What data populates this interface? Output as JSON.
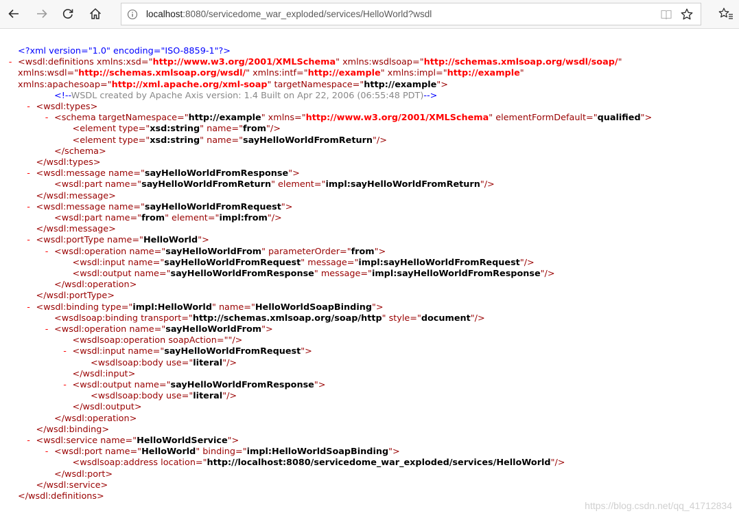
{
  "browser": {
    "url_host": "localhost",
    "url_path": ":8080/servicedome_war_exploded/services/HelloWorld?wsdl",
    "icons": [
      "back-arrow-icon",
      "forward-arrow-icon",
      "refresh-icon",
      "home-icon",
      "info-icon",
      "reading-view-icon",
      "favorite-star-icon",
      "favorites-hub-icon"
    ]
  },
  "colors": {
    "tag": "#990000",
    "toggle": "#ff0000",
    "namespace_value": "#ff0000",
    "processing_instruction": "#0000ff",
    "comment_text": "#888888",
    "value": "#000000"
  },
  "xml": {
    "lines": [
      {
        "toggle": "",
        "indent": 0,
        "parts": [
          [
            "p",
            "<?xml version=\"1.0\" encoding=\"ISO-8859-1\"?>"
          ]
        ]
      },
      {
        "toggle": "-",
        "indent": 0,
        "parts": [
          [
            "t",
            "<wsdl:definitions "
          ],
          [
            "a",
            "xmlns:xsd=\""
          ],
          [
            "ns",
            "http://www.w3.org/2001/XMLSchema"
          ],
          [
            "a",
            "\" xmlns:wsdlsoap=\""
          ],
          [
            "ns",
            "http://schemas.xmlsoap.org/wsdl/soap/"
          ],
          [
            "a",
            "\""
          ]
        ]
      },
      {
        "toggle": "",
        "indent": 0,
        "parts": [
          [
            "a",
            "xmlns:wsdl=\""
          ],
          [
            "ns",
            "http://schemas.xmlsoap.org/wsdl/"
          ],
          [
            "a",
            "\" xmlns:intf=\""
          ],
          [
            "ns",
            "http://example"
          ],
          [
            "a",
            "\" xmlns:impl=\""
          ],
          [
            "ns",
            "http://example"
          ],
          [
            "a",
            "\""
          ]
        ]
      },
      {
        "toggle": "",
        "indent": 0,
        "parts": [
          [
            "a",
            "xmlns:apachesoap=\""
          ],
          [
            "ns",
            "http://xml.apache.org/xml-soap"
          ],
          [
            "a",
            "\" targetNamespace=\""
          ],
          [
            "v",
            "http://example"
          ],
          [
            "t",
            "\">"
          ]
        ]
      },
      {
        "toggle": "",
        "indent": 2,
        "parts": [
          [
            "cmd",
            "<!--"
          ],
          [
            "cm",
            "WSDL created by Apache Axis version: 1.4 Built on Apr 22, 2006 (06:55:48 PDT)"
          ],
          [
            "cmd",
            "-->"
          ]
        ]
      },
      {
        "toggle": "-",
        "indent": 1,
        "parts": [
          [
            "t",
            "<wsdl:types>"
          ]
        ]
      },
      {
        "toggle": "-",
        "indent": 2,
        "parts": [
          [
            "t",
            "<schema "
          ],
          [
            "a",
            "targetNamespace=\""
          ],
          [
            "v",
            "http://example"
          ],
          [
            "a",
            "\" xmlns=\""
          ],
          [
            "ns",
            "http://www.w3.org/2001/XMLSchema"
          ],
          [
            "a",
            "\" elementFormDefault=\""
          ],
          [
            "v",
            "qualified"
          ],
          [
            "t",
            "\">"
          ]
        ]
      },
      {
        "toggle": "",
        "indent": 3,
        "parts": [
          [
            "t",
            "<element "
          ],
          [
            "a",
            "type=\""
          ],
          [
            "v",
            "xsd:string"
          ],
          [
            "a",
            "\" name=\""
          ],
          [
            "v",
            "from"
          ],
          [
            "t",
            "\"/>"
          ]
        ]
      },
      {
        "toggle": "",
        "indent": 3,
        "parts": [
          [
            "t",
            "<element "
          ],
          [
            "a",
            "type=\""
          ],
          [
            "v",
            "xsd:string"
          ],
          [
            "a",
            "\" name=\""
          ],
          [
            "v",
            "sayHelloWorldFromReturn"
          ],
          [
            "t",
            "\"/>"
          ]
        ]
      },
      {
        "toggle": "",
        "indent": 2,
        "parts": [
          [
            "t",
            "</schema>"
          ]
        ]
      },
      {
        "toggle": "",
        "indent": 1,
        "parts": [
          [
            "t",
            "</wsdl:types>"
          ]
        ]
      },
      {
        "toggle": "-",
        "indent": 1,
        "parts": [
          [
            "t",
            "<wsdl:message "
          ],
          [
            "a",
            "name=\""
          ],
          [
            "v",
            "sayHelloWorldFromResponse"
          ],
          [
            "t",
            "\">"
          ]
        ]
      },
      {
        "toggle": "",
        "indent": 2,
        "parts": [
          [
            "t",
            "<wsdl:part "
          ],
          [
            "a",
            "name=\""
          ],
          [
            "v",
            "sayHelloWorldFromReturn"
          ],
          [
            "a",
            "\" element=\""
          ],
          [
            "v",
            "impl:sayHelloWorldFromReturn"
          ],
          [
            "t",
            "\"/>"
          ]
        ]
      },
      {
        "toggle": "",
        "indent": 1,
        "parts": [
          [
            "t",
            "</wsdl:message>"
          ]
        ]
      },
      {
        "toggle": "-",
        "indent": 1,
        "parts": [
          [
            "t",
            "<wsdl:message "
          ],
          [
            "a",
            "name=\""
          ],
          [
            "v",
            "sayHelloWorldFromRequest"
          ],
          [
            "t",
            "\">"
          ]
        ]
      },
      {
        "toggle": "",
        "indent": 2,
        "parts": [
          [
            "t",
            "<wsdl:part "
          ],
          [
            "a",
            "name=\""
          ],
          [
            "v",
            "from"
          ],
          [
            "a",
            "\" element=\""
          ],
          [
            "v",
            "impl:from"
          ],
          [
            "t",
            "\"/>"
          ]
        ]
      },
      {
        "toggle": "",
        "indent": 1,
        "parts": [
          [
            "t",
            "</wsdl:message>"
          ]
        ]
      },
      {
        "toggle": "-",
        "indent": 1,
        "parts": [
          [
            "t",
            "<wsdl:portType "
          ],
          [
            "a",
            "name=\""
          ],
          [
            "v",
            "HelloWorld"
          ],
          [
            "t",
            "\">"
          ]
        ]
      },
      {
        "toggle": "-",
        "indent": 2,
        "parts": [
          [
            "t",
            "<wsdl:operation "
          ],
          [
            "a",
            "name=\""
          ],
          [
            "v",
            "sayHelloWorldFrom"
          ],
          [
            "a",
            "\" parameterOrder=\""
          ],
          [
            "v",
            "from"
          ],
          [
            "t",
            "\">"
          ]
        ]
      },
      {
        "toggle": "",
        "indent": 3,
        "parts": [
          [
            "t",
            "<wsdl:input "
          ],
          [
            "a",
            "name=\""
          ],
          [
            "v",
            "sayHelloWorldFromRequest"
          ],
          [
            "a",
            "\" message=\""
          ],
          [
            "v",
            "impl:sayHelloWorldFromRequest"
          ],
          [
            "t",
            "\"/>"
          ]
        ]
      },
      {
        "toggle": "",
        "indent": 3,
        "parts": [
          [
            "t",
            "<wsdl:output "
          ],
          [
            "a",
            "name=\""
          ],
          [
            "v",
            "sayHelloWorldFromResponse"
          ],
          [
            "a",
            "\" message=\""
          ],
          [
            "v",
            "impl:sayHelloWorldFromResponse"
          ],
          [
            "t",
            "\"/>"
          ]
        ]
      },
      {
        "toggle": "",
        "indent": 2,
        "parts": [
          [
            "t",
            "</wsdl:operation>"
          ]
        ]
      },
      {
        "toggle": "",
        "indent": 1,
        "parts": [
          [
            "t",
            "</wsdl:portType>"
          ]
        ]
      },
      {
        "toggle": "-",
        "indent": 1,
        "parts": [
          [
            "t",
            "<wsdl:binding "
          ],
          [
            "a",
            "type=\""
          ],
          [
            "v",
            "impl:HelloWorld"
          ],
          [
            "a",
            "\" name=\""
          ],
          [
            "v",
            "HelloWorldSoapBinding"
          ],
          [
            "t",
            "\">"
          ]
        ]
      },
      {
        "toggle": "",
        "indent": 2,
        "parts": [
          [
            "t",
            "<wsdlsoap:binding "
          ],
          [
            "a",
            "transport=\""
          ],
          [
            "v",
            "http://schemas.xmlsoap.org/soap/http"
          ],
          [
            "a",
            "\" style=\""
          ],
          [
            "v",
            "document"
          ],
          [
            "t",
            "\"/>"
          ]
        ]
      },
      {
        "toggle": "-",
        "indent": 2,
        "parts": [
          [
            "t",
            "<wsdl:operation "
          ],
          [
            "a",
            "name=\""
          ],
          [
            "v",
            "sayHelloWorldFrom"
          ],
          [
            "t",
            "\">"
          ]
        ]
      },
      {
        "toggle": "",
        "indent": 3,
        "parts": [
          [
            "t",
            "<wsdlsoap:operation "
          ],
          [
            "a",
            "soapAction=\""
          ],
          [
            "v",
            ""
          ],
          [
            "t",
            "\"/>"
          ]
        ]
      },
      {
        "toggle": "-",
        "indent": 3,
        "parts": [
          [
            "t",
            "<wsdl:input "
          ],
          [
            "a",
            "name=\""
          ],
          [
            "v",
            "sayHelloWorldFromRequest"
          ],
          [
            "t",
            "\">"
          ]
        ]
      },
      {
        "toggle": "",
        "indent": 4,
        "parts": [
          [
            "t",
            "<wsdlsoap:body "
          ],
          [
            "a",
            "use=\""
          ],
          [
            "v",
            "literal"
          ],
          [
            "t",
            "\"/>"
          ]
        ]
      },
      {
        "toggle": "",
        "indent": 3,
        "parts": [
          [
            "t",
            "</wsdl:input>"
          ]
        ]
      },
      {
        "toggle": "-",
        "indent": 3,
        "parts": [
          [
            "t",
            "<wsdl:output "
          ],
          [
            "a",
            "name=\""
          ],
          [
            "v",
            "sayHelloWorldFromResponse"
          ],
          [
            "t",
            "\">"
          ]
        ]
      },
      {
        "toggle": "",
        "indent": 4,
        "parts": [
          [
            "t",
            "<wsdlsoap:body "
          ],
          [
            "a",
            "use=\""
          ],
          [
            "v",
            "literal"
          ],
          [
            "t",
            "\"/>"
          ]
        ]
      },
      {
        "toggle": "",
        "indent": 3,
        "parts": [
          [
            "t",
            "</wsdl:output>"
          ]
        ]
      },
      {
        "toggle": "",
        "indent": 2,
        "parts": [
          [
            "t",
            "</wsdl:operation>"
          ]
        ]
      },
      {
        "toggle": "",
        "indent": 1,
        "parts": [
          [
            "t",
            "</wsdl:binding>"
          ]
        ]
      },
      {
        "toggle": "-",
        "indent": 1,
        "parts": [
          [
            "t",
            "<wsdl:service "
          ],
          [
            "a",
            "name=\""
          ],
          [
            "v",
            "HelloWorldService"
          ],
          [
            "t",
            "\">"
          ]
        ]
      },
      {
        "toggle": "-",
        "indent": 2,
        "parts": [
          [
            "t",
            "<wsdl:port "
          ],
          [
            "a",
            "name=\""
          ],
          [
            "v",
            "HelloWorld"
          ],
          [
            "a",
            "\" binding=\""
          ],
          [
            "v",
            "impl:HelloWorldSoapBinding"
          ],
          [
            "t",
            "\">"
          ]
        ]
      },
      {
        "toggle": "",
        "indent": 3,
        "parts": [
          [
            "t",
            "<wsdlsoap:address "
          ],
          [
            "a",
            "location=\""
          ],
          [
            "v",
            "http://localhost:8080/servicedome_war_exploded/services/HelloWorld"
          ],
          [
            "t",
            "\"/>"
          ]
        ]
      },
      {
        "toggle": "",
        "indent": 2,
        "parts": [
          [
            "t",
            "</wsdl:port>"
          ]
        ]
      },
      {
        "toggle": "",
        "indent": 1,
        "parts": [
          [
            "t",
            "</wsdl:service>"
          ]
        ]
      },
      {
        "toggle": "",
        "indent": 0,
        "parts": [
          [
            "t",
            "</wsdl:definitions>"
          ]
        ]
      }
    ]
  },
  "watermark": "https://blog.csdn.net/qq_41712834"
}
